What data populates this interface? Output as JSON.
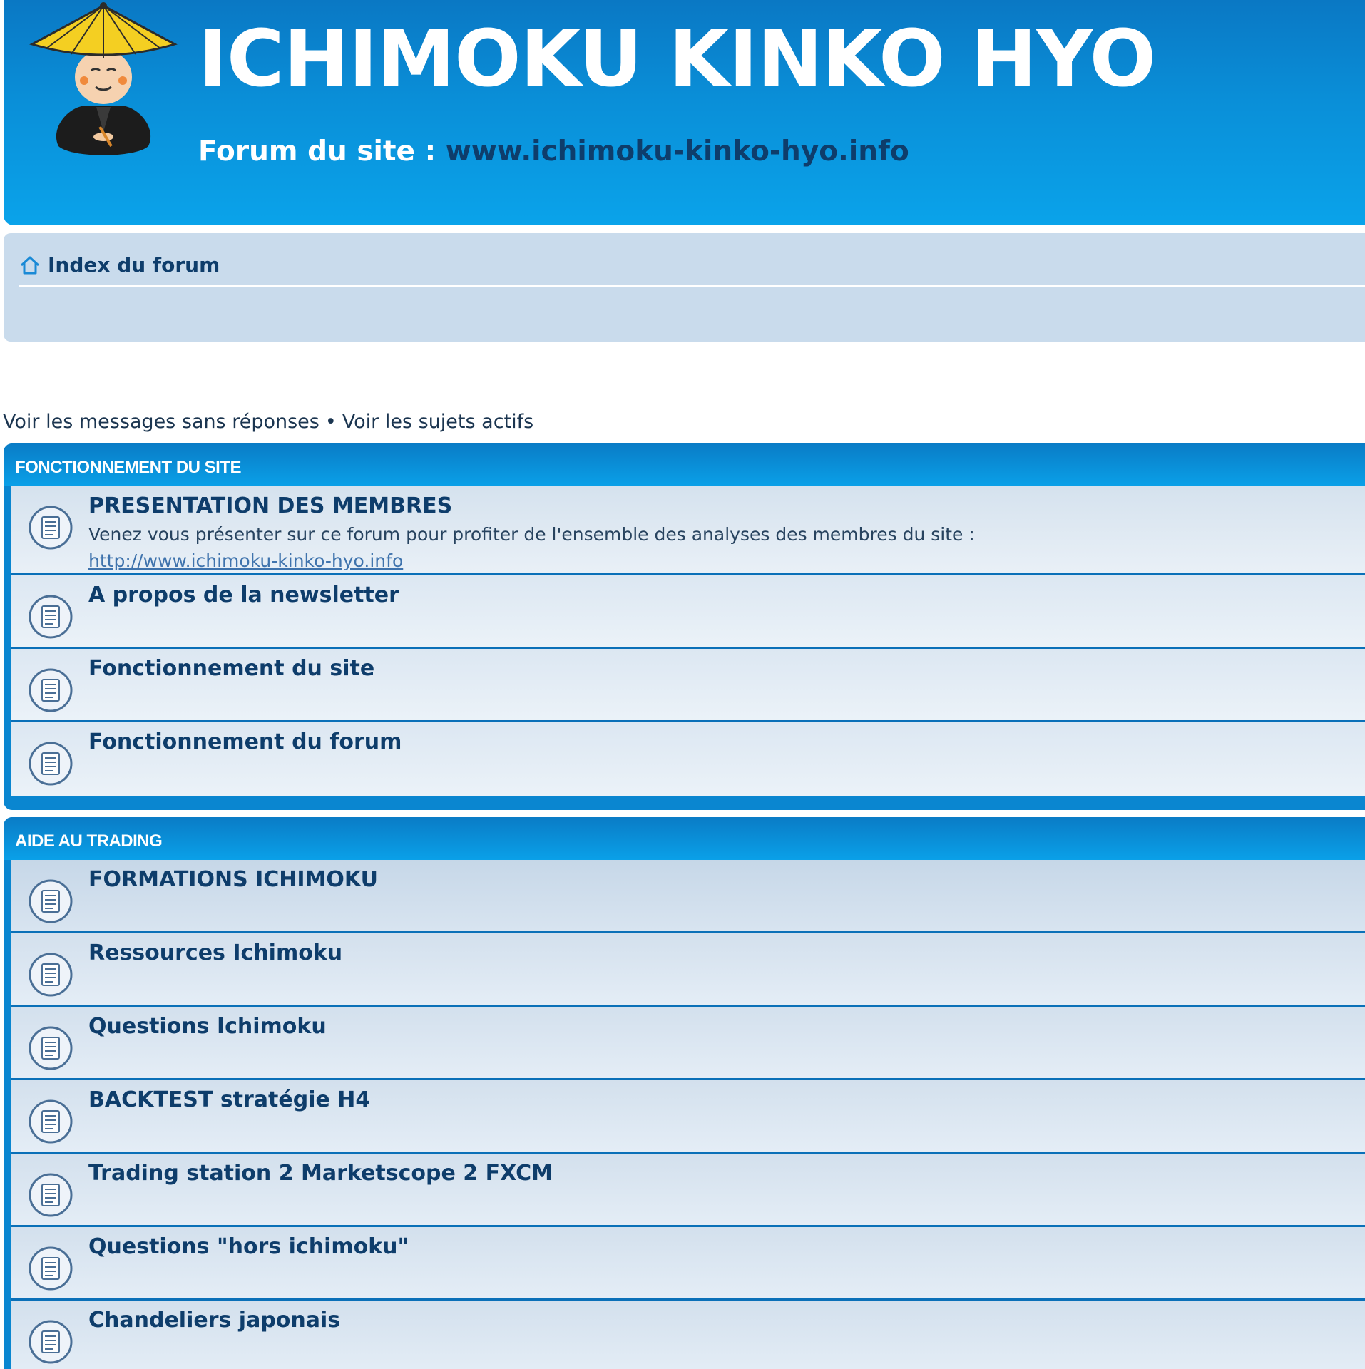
{
  "header": {
    "title": "ICHIMOKU KINKO HYO",
    "subtitle_label": "Forum du site :",
    "subtitle_url": "www.ichimoku-kinko-hyo.info"
  },
  "navbar": {
    "home_icon": "home-icon",
    "index_label": "Index du forum"
  },
  "quick_links": {
    "unanswered": "Voir les messages sans réponses",
    "separator": "•",
    "active": "Voir les sujets actifs"
  },
  "categories": [
    {
      "title": "FONCTIONNEMENT DU SITE",
      "forums": [
        {
          "title": "PRESENTATION DES MEMBRES",
          "description": "Venez vous présenter sur ce forum pour profiter de l'ensemble des analyses des membres du site :",
          "link": "http://www.ichimoku-kinko-hyo.info"
        },
        {
          "title": "A propos de la newsletter"
        },
        {
          "title": "Fonctionnement du site"
        },
        {
          "title": "Fonctionnement du forum"
        }
      ]
    },
    {
      "title": "AIDE AU TRADING",
      "forums": [
        {
          "title": "FORMATIONS ICHIMOKU"
        },
        {
          "title": "Ressources Ichimoku"
        },
        {
          "title": "Questions Ichimoku"
        },
        {
          "title": "BACKTEST stratégie H4"
        },
        {
          "title": "Trading station 2 Marketscope 2 FXCM"
        },
        {
          "title": "Questions \"hors ichimoku\""
        },
        {
          "title": "Chandeliers japonais"
        }
      ]
    }
  ],
  "icons": {
    "forum_icon": "forum-read-icon",
    "mascot": "mascot-logo"
  },
  "colors": {
    "header_blue": "#0a8fd8",
    "category_blue": "#0a86d0",
    "navbar_bg": "#c9dbec",
    "title_text": "#0e3d6b",
    "link_text": "#3f73ad"
  }
}
